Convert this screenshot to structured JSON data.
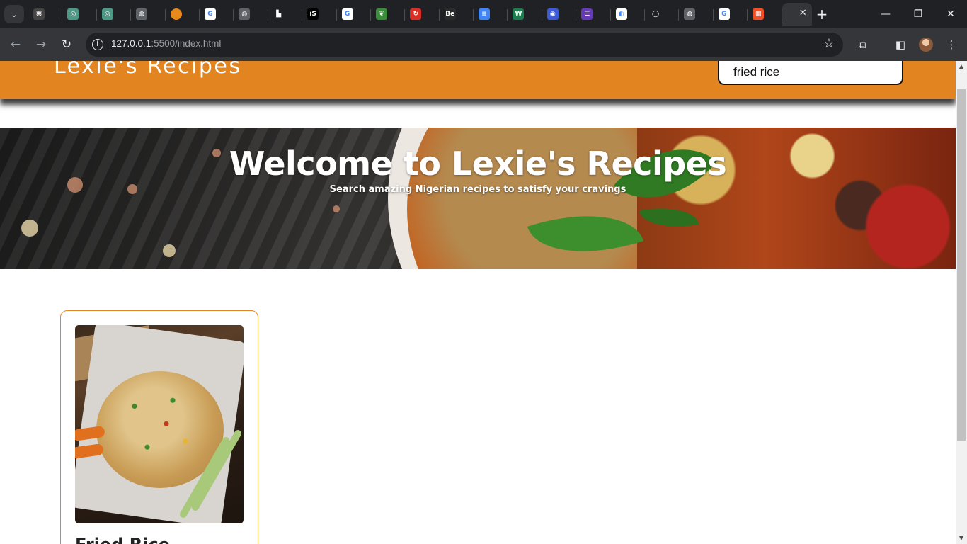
{
  "browser": {
    "tabs": [
      {
        "icon": "codepen-icon",
        "letter": "⌘",
        "color": "#444444"
      },
      {
        "icon": "chatgpt-icon",
        "letter": "◎",
        "color": "#4a9a86"
      },
      {
        "icon": "chatgpt-icon",
        "letter": "◎",
        "color": "#4a9a86"
      },
      {
        "icon": "globe-icon",
        "letter": "◍",
        "color": "#5f6368"
      },
      {
        "icon": "orange-dot-icon",
        "letter": "",
        "color": "#e8891c"
      },
      {
        "icon": "google-icon",
        "letter": "G",
        "color": "#ffffff"
      },
      {
        "icon": "globe-icon",
        "letter": "◍",
        "color": "#5f6368"
      },
      {
        "icon": "bank-icon",
        "letter": "▙",
        "color": "#202124"
      },
      {
        "icon": "is-icon",
        "letter": "iS",
        "color": "#000000"
      },
      {
        "icon": "google-icon",
        "letter": "G",
        "color": "#ffffff"
      },
      {
        "icon": "leaf-icon",
        "letter": "❦",
        "color": "#3b8c3b"
      },
      {
        "icon": "red-app-icon",
        "letter": "↻",
        "color": "#d93025"
      },
      {
        "icon": "behance-icon",
        "letter": "Bē",
        "color": "#2b2b2b"
      },
      {
        "icon": "docs-icon",
        "letter": "≡",
        "color": "#4285f4"
      },
      {
        "icon": "w-icon",
        "letter": "W",
        "color": "#1e7d4e"
      },
      {
        "icon": "chrome-icon",
        "letter": "◉",
        "color": "#3c5ad8"
      },
      {
        "icon": "forms-icon",
        "letter": "☰",
        "color": "#673ab7"
      },
      {
        "icon": "github-icon",
        "letter": "◐",
        "color": "#ffffff"
      },
      {
        "icon": "github-icon",
        "letter": "◯",
        "color": "#202124"
      },
      {
        "icon": "globe-icon",
        "letter": "◍",
        "color": "#5f6368"
      },
      {
        "icon": "google-icon",
        "letter": "G",
        "color": "#ffffff"
      },
      {
        "icon": "microsoft-icon",
        "letter": "▦",
        "color": "#f25022"
      }
    ],
    "url_host": "127.0.0.1",
    "url_path": ":5500/index.html"
  },
  "site": {
    "logo": "Lexie's Recipes",
    "search_value": "fried rice"
  },
  "hero": {
    "title": "Welcome to Lexie's Recipes",
    "subtitle": "Search amazing Nigerian recipes to satisfy your cravings"
  },
  "recipes": [
    {
      "name": "Fried Rice"
    }
  ]
}
